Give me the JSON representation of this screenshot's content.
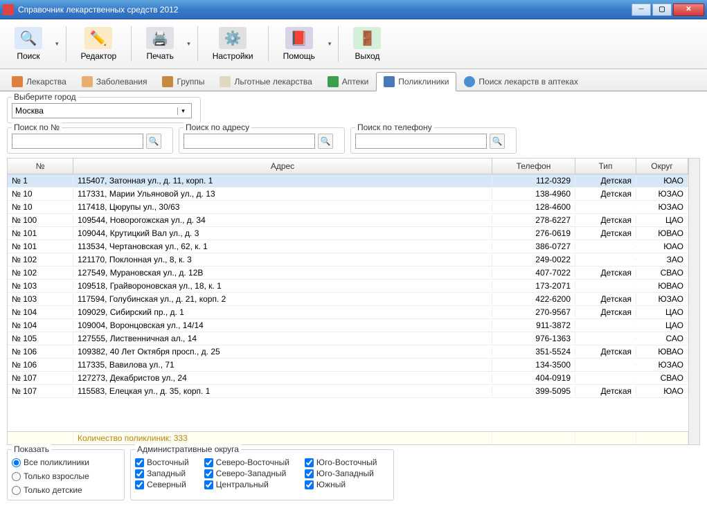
{
  "window": {
    "title": "Справочник лекарственных средств 2012"
  },
  "toolbar": {
    "search": "Поиск",
    "editor": "Редактор",
    "print": "Печать",
    "settings": "Настройки",
    "help": "Помощь",
    "exit": "Выход"
  },
  "tabs": {
    "meds": "Лекарства",
    "diseases": "Заболевания",
    "groups": "Группы",
    "benefit": "Льготные лекарства",
    "pharmacies": "Аптеки",
    "clinics": "Поликлиники",
    "search_in_pharm": "Поиск лекарств в аптеках"
  },
  "city": {
    "label": "Выберите город",
    "value": "Москва"
  },
  "searchboxes": {
    "by_no": "Поиск по №",
    "by_addr": "Поиск по адресу",
    "by_tel": "Поиск по телефону"
  },
  "columns": {
    "no": "№",
    "addr": "Адрес",
    "tel": "Телефон",
    "type": "Тип",
    "okr": "Округ"
  },
  "rows": [
    {
      "no": "№ 1",
      "addr": "115407, Затонная ул., д. 11, корп. 1",
      "tel": "112-0329",
      "type": "Детская",
      "okr": "ЮАО"
    },
    {
      "no": "№ 10",
      "addr": "117331, Марии Ульяновой ул., д. 13",
      "tel": "138-4960",
      "type": "Детская",
      "okr": "ЮЗАО"
    },
    {
      "no": "№ 10",
      "addr": "117418, Цюрупы ул., 30/63",
      "tel": "128-4600",
      "type": "",
      "okr": "ЮЗАО"
    },
    {
      "no": "№ 100",
      "addr": "109544, Новорогожская ул., д. 34",
      "tel": "278-6227",
      "type": "Детская",
      "okr": "ЦАО"
    },
    {
      "no": "№ 101",
      "addr": "109044, Крутицкий Вал ул., д. 3",
      "tel": "276-0619",
      "type": "Детская",
      "okr": "ЮВАО"
    },
    {
      "no": "№ 101",
      "addr": "113534, Чертановская ул., 62, к. 1",
      "tel": "386-0727",
      "type": "",
      "okr": "ЮАО"
    },
    {
      "no": "№ 102",
      "addr": "121170, Поклонная ул., 8, к. 3",
      "tel": "249-0022",
      "type": "",
      "okr": "ЗАО"
    },
    {
      "no": "№ 102",
      "addr": "127549, Мурановская ул., д. 12В",
      "tel": "407-7022",
      "type": "Детская",
      "okr": "СВАО"
    },
    {
      "no": "№ 103",
      "addr": "109518, Грайвороновская ул., 18, к. 1",
      "tel": "173-2071",
      "type": "",
      "okr": "ЮВАО"
    },
    {
      "no": "№ 103",
      "addr": "117594, Голубинская ул., д. 21, корп. 2",
      "tel": "422-6200",
      "type": "Детская",
      "okr": "ЮЗАО"
    },
    {
      "no": "№ 104",
      "addr": "109029, Сибирский пр., д. 1",
      "tel": "270-9567",
      "type": "Детская",
      "okr": "ЦАО"
    },
    {
      "no": "№ 104",
      "addr": "109004, Воронцовская ул., 14/14",
      "tel": "911-3872",
      "type": "",
      "okr": "ЦАО"
    },
    {
      "no": "№ 105",
      "addr": "127555, Лиственничная ал., 14",
      "tel": "976-1363",
      "type": "",
      "okr": "САО"
    },
    {
      "no": "№ 106",
      "addr": "109382, 40 Лет Октября просп., д. 25",
      "tel": "351-5524",
      "type": "Детская",
      "okr": "ЮВАО"
    },
    {
      "no": "№ 106",
      "addr": "117335, Вавилова ул., 71",
      "tel": "134-3500",
      "type": "",
      "okr": "ЮЗАО"
    },
    {
      "no": "№ 107",
      "addr": "127273, Декабристов ул., 24",
      "tel": "404-0919",
      "type": "",
      "okr": "СВАО"
    },
    {
      "no": "№ 107",
      "addr": "115583, Елецкая ул., д. 35, корп. 1",
      "tel": "399-5095",
      "type": "Детская",
      "okr": "ЮАО"
    }
  ],
  "footer": {
    "count_label": "Количество поликлиник: 333"
  },
  "filters": {
    "show_legend": "Показать",
    "districts_legend": "Административные округа",
    "radios": {
      "all": "Все поликлиники",
      "adult": "Только взрослые",
      "kids": "Только детские"
    },
    "districts": {
      "east": "Восточный",
      "west": "Западный",
      "north": "Северный",
      "ne": "Северо-Восточный",
      "nw": "Северо-Западный",
      "center": "Центральный",
      "se": "Юго-Восточный",
      "sw": "Юго-Западный",
      "south": "Южный"
    }
  }
}
